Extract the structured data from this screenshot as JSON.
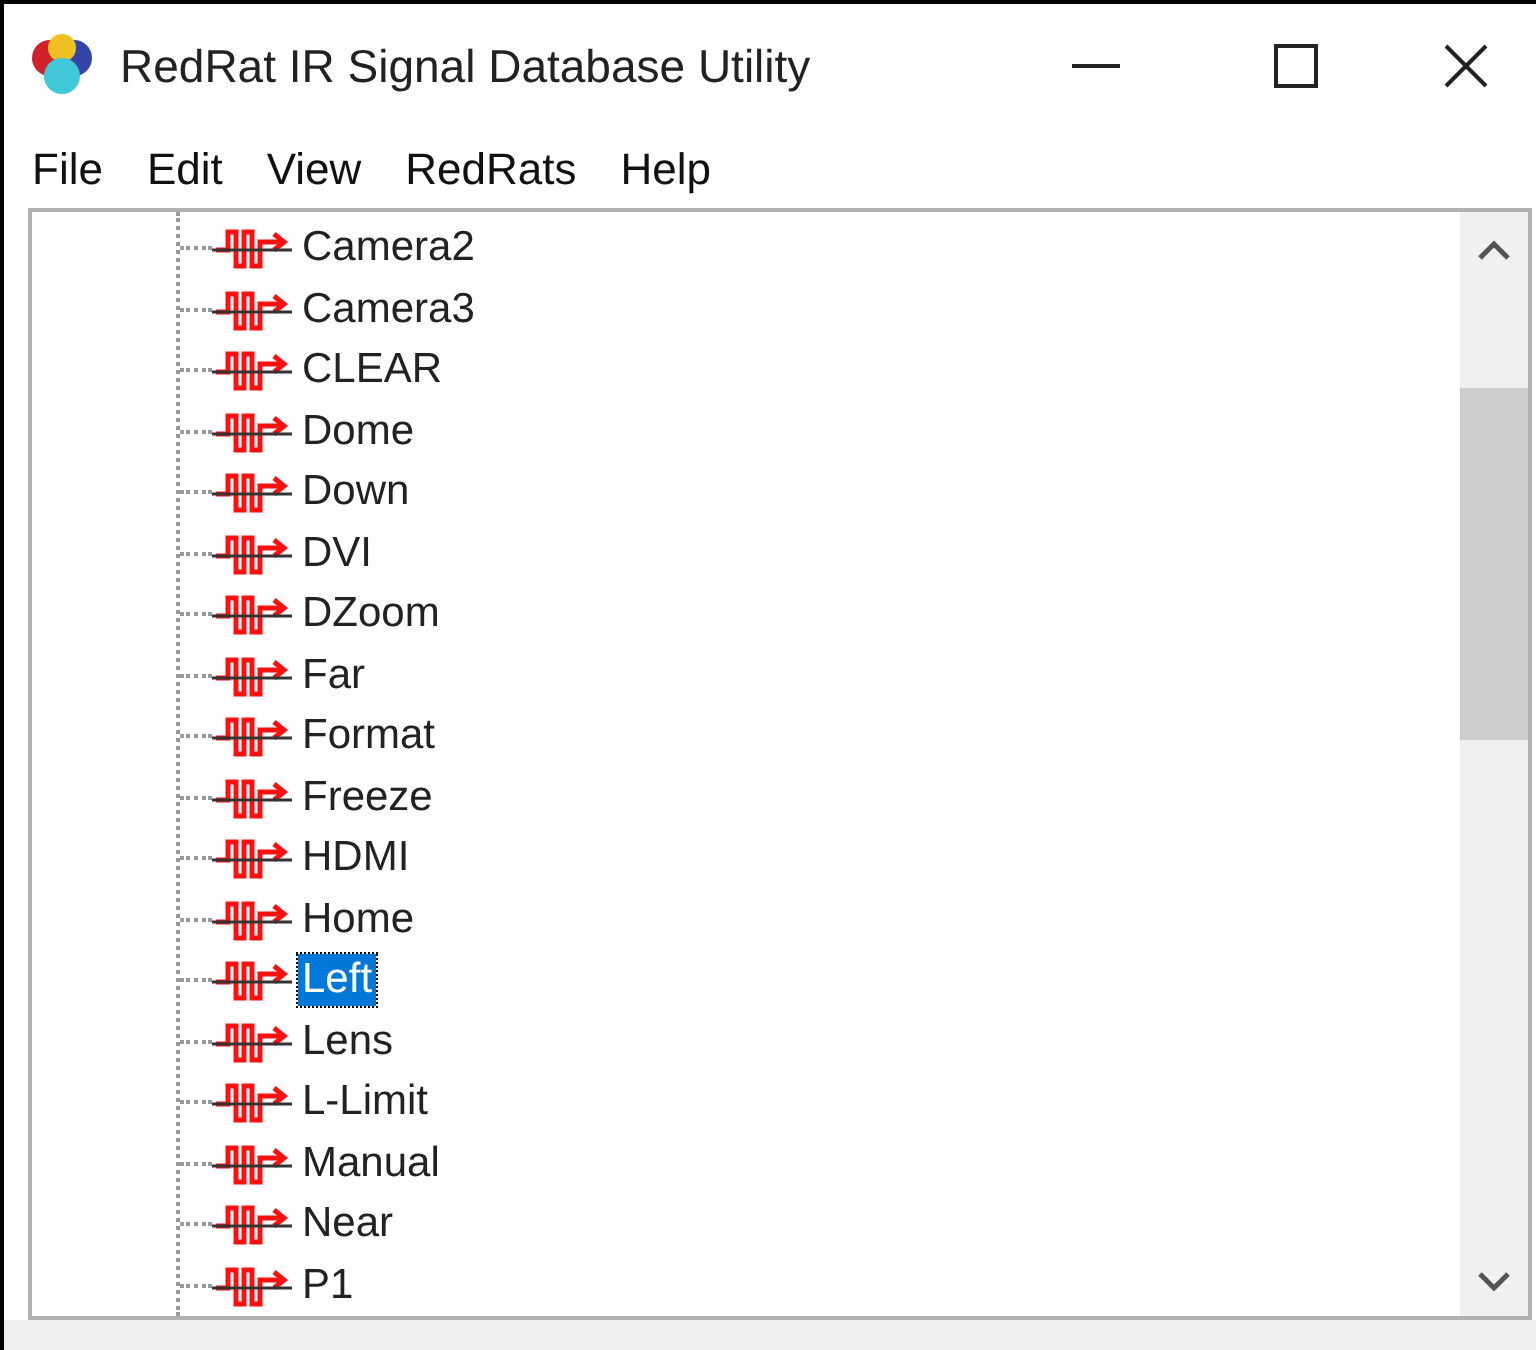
{
  "window": {
    "title": "RedRat IR Signal Database Utility"
  },
  "menu": [
    "File",
    "Edit",
    "View",
    "RedRats",
    "Help"
  ],
  "tree": {
    "items": [
      {
        "label": "Camera2",
        "selected": false
      },
      {
        "label": "Camera3",
        "selected": false
      },
      {
        "label": "CLEAR",
        "selected": false
      },
      {
        "label": "Dome",
        "selected": false
      },
      {
        "label": "Down",
        "selected": false
      },
      {
        "label": "DVI",
        "selected": false
      },
      {
        "label": "DZoom",
        "selected": false
      },
      {
        "label": "Far",
        "selected": false
      },
      {
        "label": "Format",
        "selected": false
      },
      {
        "label": "Freeze",
        "selected": false
      },
      {
        "label": "HDMI",
        "selected": false
      },
      {
        "label": "Home",
        "selected": false
      },
      {
        "label": "Left",
        "selected": true
      },
      {
        "label": "Lens",
        "selected": false
      },
      {
        "label": "L-Limit",
        "selected": false
      },
      {
        "label": "Manual",
        "selected": false
      },
      {
        "label": "Near",
        "selected": false
      },
      {
        "label": "P1",
        "selected": false
      }
    ]
  }
}
